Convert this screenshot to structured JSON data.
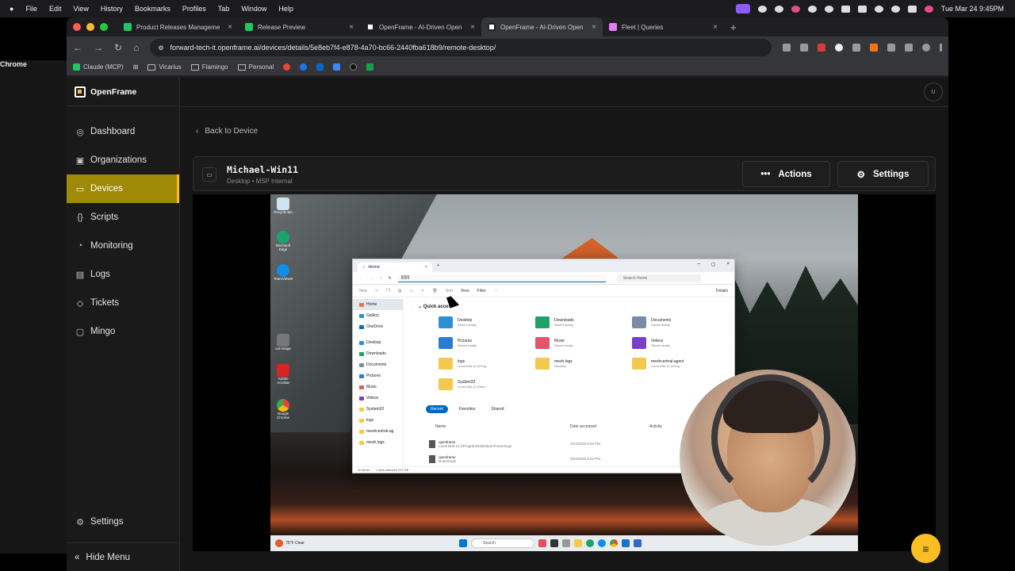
{
  "macos": {
    "menu": [
      "Chrome",
      "File",
      "Edit",
      "View",
      "History",
      "Bookmarks",
      "Profiles",
      "Tab",
      "Window",
      "Help"
    ],
    "clock": "Tue Mar 24  9:45PM"
  },
  "browser": {
    "tabs": [
      {
        "title": "Product Releases Manageme",
        "fav_color": "#22c55e",
        "active": false
      },
      {
        "title": "Release Preview",
        "fav_color": "#22c55e",
        "active": false
      },
      {
        "title": "OpenFrame - AI-Driven Open",
        "fav_color": "#ffffff",
        "active": false
      },
      {
        "title": "OpenFrame - AI-Driven Open",
        "fav_color": "#ffffff",
        "active": true
      },
      {
        "title": "Fleet | Queries",
        "fav_color": "#e879f9",
        "active": false
      }
    ],
    "url": "forward-tech-it.openframe.ai/devices/details/5e8eb7f4-e878-4a70-bc66-2440fba618b9/remote-desktop/",
    "bookmarks": [
      "Claude (MCP)",
      "Vicarius",
      "Flamingo",
      "Personal"
    ]
  },
  "app": {
    "brand": "OpenFrame",
    "nav": [
      {
        "label": "Dashboard",
        "icon": "dashboard-icon",
        "glyph": "◎"
      },
      {
        "label": "Organizations",
        "icon": "organizations-icon",
        "glyph": "▣"
      },
      {
        "label": "Devices",
        "icon": "devices-icon",
        "glyph": "▭"
      },
      {
        "label": "Scripts",
        "icon": "scripts-icon",
        "glyph": "{}"
      },
      {
        "label": "Monitoring",
        "icon": "monitoring-icon",
        "glyph": "◔"
      },
      {
        "label": "Logs",
        "icon": "logs-icon",
        "glyph": "▤"
      },
      {
        "label": "Tickets",
        "icon": "tickets-icon",
        "glyph": "◇"
      },
      {
        "label": "Mingo",
        "icon": "mingo-icon",
        "glyph": "▢"
      }
    ],
    "active_nav": "Devices",
    "settings_label": "Settings",
    "hide_menu_label": "Hide Menu",
    "user_initial": "U",
    "accent": "#fbbf24"
  },
  "device": {
    "back_label": "Back to Device",
    "name": "Michael-Win11",
    "subtitle": "Desktop • MSP Internal",
    "actions_label": "Actions",
    "settings_label": "Settings"
  },
  "remote": {
    "desktop_icons": [
      "Recycle Bin",
      "Microsoft Edge",
      "TeamViewer",
      "cat-image",
      "Adobe Acrobat",
      "Google Chrome"
    ],
    "taskbar_search": "Search",
    "taskbar_weather": "75°F Clear",
    "explorer": {
      "tab_title": "Home",
      "address": "||||||||",
      "search_placeholder": "Search Home",
      "toolbar": [
        "New",
        "Sort",
        "View",
        "Filter",
        "Details"
      ],
      "nav": [
        "Home",
        "Gallery",
        "OneDrive",
        "Desktop",
        "Downloads",
        "Documents",
        "Pictures",
        "Music",
        "Videos",
        "System32",
        "logs",
        "meshcentral-ag",
        "mesh.logs"
      ],
      "quick_access_label": "Quick access",
      "folders": [
        {
          "name": "Desktop",
          "sub": "Stored locally",
          "color": "#2d8fd6"
        },
        {
          "name": "Downloads",
          "sub": "Stored locally",
          "color": "#22a06b"
        },
        {
          "name": "Documents",
          "sub": "Stored locally",
          "color": "#7a8ca3"
        },
        {
          "name": "Pictures",
          "sub": "Stored locally",
          "color": "#2b7bd1"
        },
        {
          "name": "Music",
          "sub": "Stored locally",
          "color": "#e0566b"
        },
        {
          "name": "Videos",
          "sub": "Stored locally",
          "color": "#7b3fc7"
        },
        {
          "name": "logs",
          "sub": "Local Disk (C:)\\Prog...",
          "color": "#f2c94c"
        },
        {
          "name": "mesh.logs",
          "sub": "Desktop",
          "color": "#f2c94c"
        },
        {
          "name": "meshcentral-agent",
          "sub": "Local Disk (C:)\\Prog...",
          "color": "#f2c94c"
        },
        {
          "name": "System32",
          "sub": "Local Disk (C:)\\Win...",
          "color": "#f2c94c"
        }
      ],
      "chips": [
        "Recent",
        "Favorites",
        "Shared"
      ],
      "columns": [
        "Name",
        "Date accessed",
        "Activity"
      ],
      "recent": [
        {
          "name": "openframe",
          "path": "Local Disk (C:)\\ProgramData\\OpenFrame\\logs",
          "date": "3/24/2026 9:04 PM"
        },
        {
          "name": "openframe",
          "path": "Downloads",
          "date": "3/24/2026 9:03 PM"
        }
      ],
      "status": [
        "30 items",
        "1 item selected  297 KB"
      ]
    }
  }
}
